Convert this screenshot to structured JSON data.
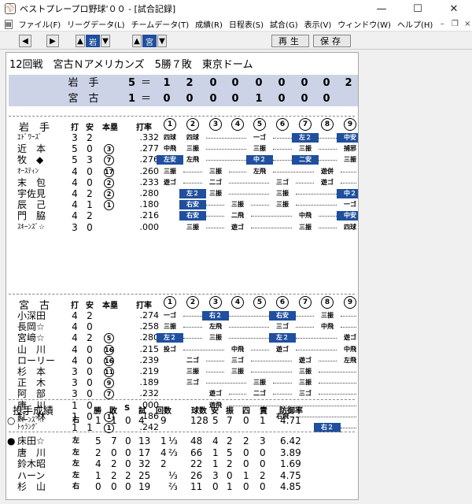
{
  "window": {
    "title": "ベストプレープロ野球'００ - [試合記録]",
    "app_icon": "baseball-icon",
    "controls": [
      "minimize-icon",
      "maximize-icon",
      "close-icon"
    ]
  },
  "menu": [
    "ファイル(F)",
    "リーグデータ(L)",
    "チームデータ(T)",
    "成績(R)",
    "日程表(S)",
    "試合(G)",
    "表示(V)",
    "ウィンドウ(W)",
    "ヘルプ(H)"
  ],
  "toolbar": {
    "prev_game": "◆",
    "next_game": "◆",
    "team1_label": "岩",
    "team2_label": "宮",
    "replay_label": "再生",
    "save_label": "保存"
  },
  "game": {
    "info": "12回戦　宮古Ｎアメリカンズ　5勝７敗　東京ドーム"
  },
  "linescore": [
    {
      "team": "岩　手",
      "runs": "5",
      "eq": "＝",
      "innings": [
        "1",
        "2",
        "0",
        "0",
        "0",
        "0",
        "0",
        "0",
        "2"
      ]
    },
    {
      "team": "宮　古",
      "runs": "1",
      "eq": "＝",
      "innings": [
        "0",
        "0",
        "0",
        "0",
        "1",
        "0",
        "0",
        "0",
        ""
      ]
    }
  ],
  "batting_headers": {
    "ab": "打",
    "h": "安",
    "hr": "本塁",
    "avg": "打率"
  },
  "inning_labels": [
    "1",
    "2",
    "3",
    "4",
    "5",
    "6",
    "7",
    "8",
    "9"
  ],
  "teams": [
    {
      "name": "岩　手",
      "players": [
        {
          "name": "ｴﾄﾞﾜｰｽﾞ",
          "small": true,
          "ab": "3",
          "h": "2",
          "hr": "",
          "avg": ".332",
          "cells": [
            {
              "i": 1,
              "t": "四球"
            },
            {
              "i": 2,
              "t": "四球"
            },
            {
              "i": 5,
              "t": "一ゴ"
            },
            {
              "i": 7,
              "t": "左２",
              "b": true
            },
            {
              "i": 9,
              "t": "中安",
              "b": true
            }
          ]
        },
        {
          "name": "近　本",
          "ab": "5",
          "h": "0",
          "hr": "3",
          "avg": ".277",
          "cells": [
            {
              "i": 1,
              "t": "中飛"
            },
            {
              "i": 2,
              "t": "三振"
            },
            {
              "i": 5,
              "t": "三振"
            },
            {
              "i": 7,
              "t": "三振"
            },
            {
              "i": 9,
              "t": "捕邪"
            }
          ]
        },
        {
          "name": "牧　◆",
          "ab": "5",
          "h": "3",
          "hr": "7",
          "avg": ".276",
          "cells": [
            {
              "i": 1,
              "t": "左安",
              "b": true
            },
            {
              "i": 2,
              "t": "左飛"
            },
            {
              "i": 5,
              "t": "中２",
              "b": true
            },
            {
              "i": 7,
              "t": "二安",
              "b": true
            },
            {
              "i": 9,
              "t": "三振"
            }
          ]
        },
        {
          "name": "ｵｰｽﾃｨﾝ",
          "small": true,
          "ab": "4",
          "h": "0",
          "hr": "17",
          "avg": ".260",
          "cells": [
            {
              "i": 1,
              "t": "三振"
            },
            {
              "i": 3,
              "t": "三振"
            },
            {
              "i": 5,
              "t": "左飛"
            },
            {
              "i": 8,
              "t": "遊併"
            }
          ]
        },
        {
          "name": "末　包",
          "ab": "4",
          "h": "0",
          "hr": "2",
          "avg": ".233",
          "cells": [
            {
              "i": 1,
              "t": "遊ゴ"
            },
            {
              "i": 3,
              "t": "二ゴ"
            },
            {
              "i": 6,
              "t": "三ゴ"
            },
            {
              "i": 8,
              "t": "遊ゴ"
            }
          ]
        },
        {
          "name": "宇佐見",
          "ab": "4",
          "h": "2",
          "hr": "2",
          "avg": ".280",
          "cells": [
            {
              "i": 2,
              "t": "左２",
              "b": true
            },
            {
              "i": 3,
              "t": "三振"
            },
            {
              "i": 6,
              "t": "三振"
            },
            {
              "i": 9,
              "t": "中２",
              "b": true
            }
          ]
        },
        {
          "name": "辰　己",
          "ab": "4",
          "h": "1",
          "hr": "1",
          "avg": ".180",
          "cells": [
            {
              "i": 2,
              "t": "右安",
              "b": true
            },
            {
              "i": 4,
              "t": "三振"
            },
            {
              "i": 6,
              "t": "三振"
            },
            {
              "i": 9,
              "t": "一ゴ"
            }
          ]
        },
        {
          "name": "門　脇",
          "ab": "4",
          "h": "2",
          "hr": "",
          "avg": ".216",
          "cells": [
            {
              "i": 2,
              "t": "右安",
              "b": true
            },
            {
              "i": 4,
              "t": "二飛"
            },
            {
              "i": 7,
              "t": "中飛"
            },
            {
              "i": 9,
              "t": "中安",
              "b": true
            }
          ]
        },
        {
          "name": "ｽｷｰﾝｽﾞ☆",
          "small": true,
          "ab": "3",
          "h": "0",
          "hr": "",
          "avg": ".000",
          "cells": [
            {
              "i": 2,
              "t": "三振"
            },
            {
              "i": 4,
              "t": "遊ゴ"
            },
            {
              "i": 7,
              "t": "三振"
            },
            {
              "i": 9,
              "t": "四球"
            }
          ]
        }
      ]
    },
    {
      "name": "宮　古",
      "players": [
        {
          "name": "小深田",
          "ab": "4",
          "h": "2",
          "hr": "",
          "avg": ".274",
          "cells": [
            {
              "i": 1,
              "t": "一ゴ"
            },
            {
              "i": 3,
              "t": "右２",
              "b": true
            },
            {
              "i": 6,
              "t": "右安",
              "b": true
            },
            {
              "i": 8,
              "t": "三振"
            }
          ]
        },
        {
          "name": "長岡☆",
          "ab": "4",
          "h": "0",
          "hr": "",
          "avg": ".258",
          "cells": [
            {
              "i": 1,
              "t": "三振"
            },
            {
              "i": 3,
              "t": "左飛"
            },
            {
              "i": 6,
              "t": "三ゴ"
            },
            {
              "i": 8,
              "t": "中飛"
            }
          ]
        },
        {
          "name": "宮﨑☆",
          "ab": "4",
          "h": "2",
          "hr": "5",
          "avg": ".280",
          "cells": [
            {
              "i": 1,
              "t": "左２",
              "b": true
            },
            {
              "i": 3,
              "t": "三振"
            },
            {
              "i": 6,
              "t": "左２",
              "b": true
            },
            {
              "i": 9,
              "t": "遊ゴ"
            }
          ]
        },
        {
          "name": "山　川",
          "ab": "4",
          "h": "0",
          "hr": "16",
          "avg": ".215",
          "cells": [
            {
              "i": 1,
              "t": "投ゴ"
            },
            {
              "i": 4,
              "t": "中飛"
            },
            {
              "i": 6,
              "t": "遊ゴ"
            },
            {
              "i": 9,
              "t": "中飛"
            }
          ]
        },
        {
          "name": "ローリー",
          "ab": "4",
          "h": "0",
          "hr": "16",
          "avg": ".239",
          "cells": [
            {
              "i": 2,
              "t": "二ゴ"
            },
            {
              "i": 4,
              "t": "三ゴ"
            },
            {
              "i": 7,
              "t": "遊ゴ"
            },
            {
              "i": 9,
              "t": "左飛"
            }
          ]
        },
        {
          "name": "杉　本",
          "ab": "3",
          "h": "0",
          "hr": "11",
          "avg": ".219",
          "cells": [
            {
              "i": 2,
              "t": "三振"
            },
            {
              "i": 4,
              "t": "三振"
            },
            {
              "i": 7,
              "t": "三振"
            }
          ]
        },
        {
          "name": "正　木",
          "ab": "3",
          "h": "0",
          "hr": "9",
          "avg": ".189",
          "cells": [
            {
              "i": 2,
              "t": "三ゴ"
            },
            {
              "i": 5,
              "t": "三振"
            },
            {
              "i": 7,
              "t": "三振"
            }
          ]
        },
        {
          "name": "阿　部",
          "ab": "3",
          "h": "0",
          "hr": "7",
          "avg": ".232",
          "cells": [
            {
              "i": 3,
              "t": "遊ゴ"
            },
            {
              "i": 5,
              "t": "二ゴ"
            },
            {
              "i": 7,
              "t": "三ゴ"
            }
          ]
        },
        {
          "name": "唐　川",
          "ab": "1",
          "h": "0",
          "hr": "",
          "avg": ".000",
          "cells": [
            {
              "i": 3,
              "t": "遊飛"
            }
          ]
        },
        {
          "name": "紅　林",
          "ab": "1",
          "h": "0",
          "hr": "1",
          "avg": ".186",
          "cells": [
            {
              "i": 6,
              "t": "右飛"
            }
          ]
        },
        {
          "name": "ﾄｩﾗﾝｸﾞ",
          "small": true,
          "ab": "1",
          "h": "1",
          "hr": "1",
          "avg": ".242",
          "cells": [
            {
              "i": 8,
              "t": "右２",
              "b": true
            }
          ]
        }
      ]
    }
  ],
  "pitching": {
    "title": "投手成績",
    "headers": {
      "w": "勝",
      "l": "敗",
      "s": "S",
      "g": "試",
      "ip": "回数",
      "np": "球数",
      "h": "安",
      "so": "振",
      "bb": "四",
      "er": "責",
      "era": "防御率"
    },
    "winners": [
      {
        "mark": "○",
        "name": "ｽｷｰﾝｽﾞ☆",
        "small": true,
        "hand": "右",
        "w": "1",
        "l": "1",
        "s": "0",
        "g": "4",
        "ip": "9",
        "frac": "",
        "np": "128",
        "h": "5",
        "so": "7",
        "bb": "0",
        "er": "1",
        "era": "4.71"
      }
    ],
    "losers": [
      {
        "mark": "●",
        "name": "床田☆",
        "hand": "左",
        "w": "5",
        "l": "7",
        "s": "0",
        "g": "13",
        "ip": "1",
        "frac": "⅓",
        "np": "48",
        "h": "4",
        "so": "2",
        "bb": "2",
        "er": "3",
        "era": "6.42"
      },
      {
        "mark": "",
        "name": "唐　川",
        "hand": "左",
        "w": "2",
        "l": "0",
        "s": "0",
        "g": "17",
        "ip": "4",
        "frac": "⅔",
        "np": "66",
        "h": "1",
        "so": "5",
        "bb": "0",
        "er": "0",
        "era": "3.89"
      },
      {
        "mark": "",
        "name": "鈴木昭",
        "hand": "左",
        "w": "4",
        "l": "2",
        "s": "0",
        "g": "32",
        "ip": "2",
        "frac": "",
        "np": "22",
        "h": "1",
        "so": "2",
        "bb": "0",
        "er": "0",
        "era": "1.69"
      },
      {
        "mark": "",
        "name": "ハーン",
        "hand": "左",
        "w": "1",
        "l": "2",
        "s": "2",
        "g": "25",
        "ip": "",
        "frac": "⅓",
        "np": "26",
        "h": "3",
        "so": "0",
        "bb": "1",
        "er": "2",
        "era": "4.75"
      },
      {
        "mark": "",
        "name": "杉　山",
        "hand": "右",
        "w": "0",
        "l": "0",
        "s": "0",
        "g": "19",
        "ip": "",
        "frac": "⅔",
        "np": "11",
        "h": "0",
        "so": "1",
        "bb": "0",
        "er": "0",
        "era": "4.85"
      }
    ]
  }
}
